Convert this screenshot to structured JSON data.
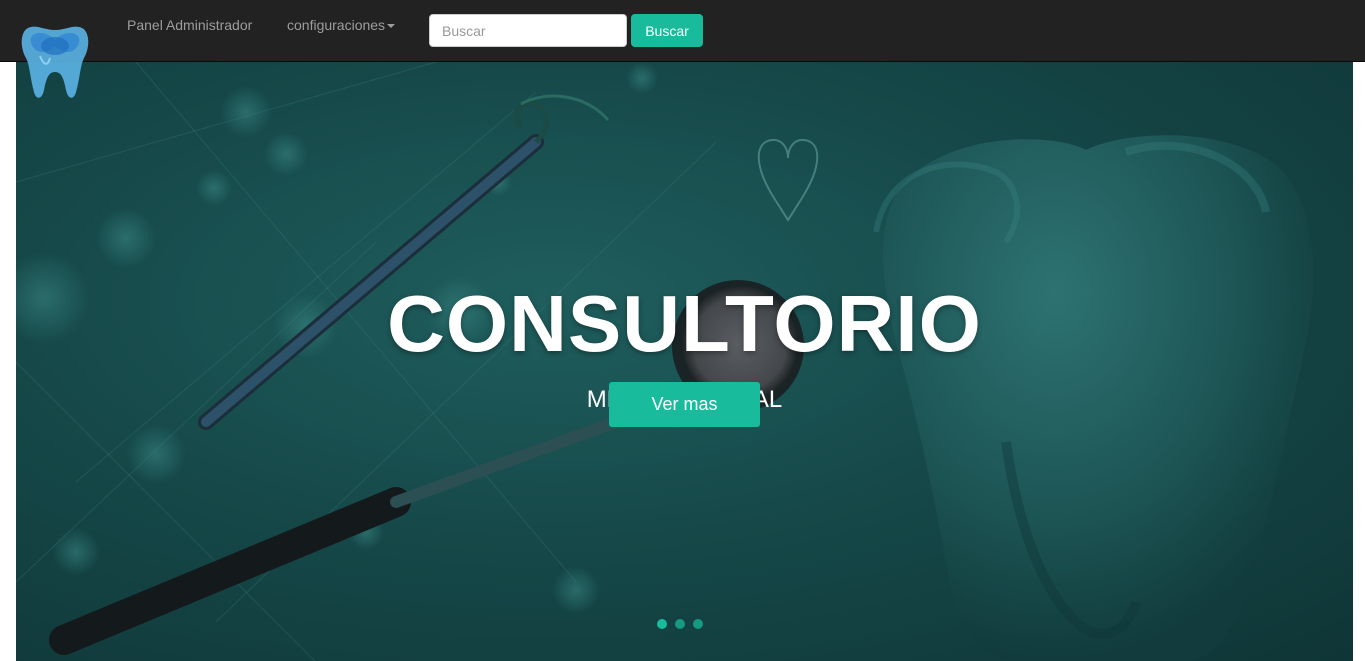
{
  "navbar": {
    "admin_label": "Panel Administrador",
    "config_label": "configuraciones",
    "search_placeholder": "Buscar",
    "search_value": "",
    "search_button": "Buscar",
    "logo_icon": "tooth-logo-icon"
  },
  "hero": {
    "title": "CONSULTORIO",
    "subtitle": "MEDICO DENTAL",
    "button_label": "Ver mas",
    "slide_count": 3,
    "active_slide": 1
  },
  "colors": {
    "navbar_bg": "#222222",
    "accent": "#18bc9c",
    "hero_bg": "#16494a",
    "nav_text": "#9d9d9d"
  }
}
